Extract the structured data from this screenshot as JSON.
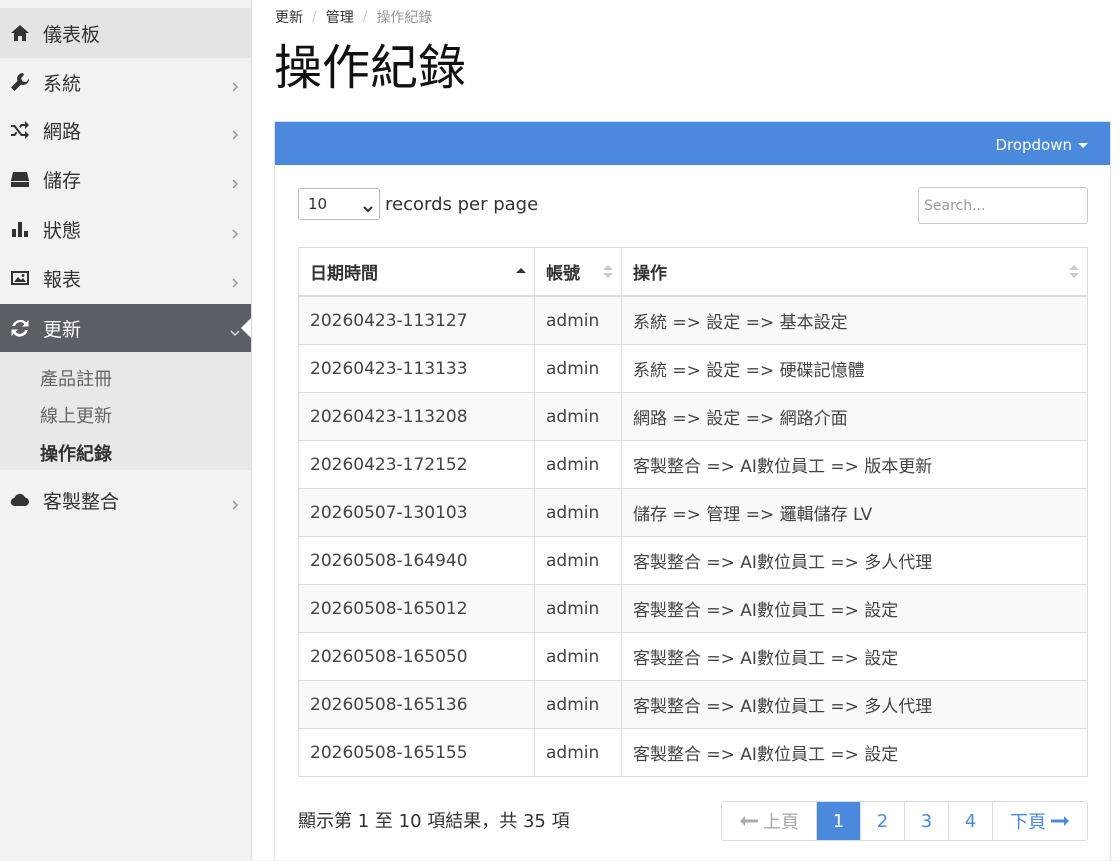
{
  "sidebar": {
    "items": [
      {
        "label": "儀表板",
        "icon": "home-icon"
      },
      {
        "label": "系統",
        "icon": "wrench-icon"
      },
      {
        "label": "網路",
        "icon": "shuffle-icon"
      },
      {
        "label": "儲存",
        "icon": "drive-icon"
      },
      {
        "label": "狀態",
        "icon": "bar-chart-icon"
      },
      {
        "label": "報表",
        "icon": "image-icon"
      },
      {
        "label": "更新",
        "icon": "refresh-icon"
      },
      {
        "label": "客製整合",
        "icon": "cloud-icon"
      }
    ],
    "sub_items": [
      "產品註冊",
      "線上更新",
      "操作紀錄"
    ]
  },
  "breadcrumb": [
    "更新",
    "管理",
    "操作紀錄"
  ],
  "page_title": "操作紀錄",
  "panel": {
    "dropdown_label": "Dropdown"
  },
  "controls": {
    "records_per_page_value": "10",
    "records_per_page_label": "records per page",
    "search_placeholder": "Search..."
  },
  "table": {
    "columns": [
      "日期時間",
      "帳號",
      "操作"
    ],
    "rows": [
      [
        "20260423-113127",
        "admin",
        "系統 => 設定 => 基本設定"
      ],
      [
        "20260423-113133",
        "admin",
        "系統 => 設定 => 硬碟記憶體"
      ],
      [
        "20260423-113208",
        "admin",
        "網路 => 設定 => 網路介面"
      ],
      [
        "20260423-172152",
        "admin",
        "客製整合 => AI數位員工 => 版本更新"
      ],
      [
        "20260507-130103",
        "admin",
        "儲存 => 管理 => 邏輯儲存 LV"
      ],
      [
        "20260508-164940",
        "admin",
        "客製整合 => AI數位員工 => 多人代理"
      ],
      [
        "20260508-165012",
        "admin",
        "客製整合 => AI數位員工 => 設定"
      ],
      [
        "20260508-165050",
        "admin",
        "客製整合 => AI數位員工 => 設定"
      ],
      [
        "20260508-165136",
        "admin",
        "客製整合 => AI數位員工 => 多人代理"
      ],
      [
        "20260508-165155",
        "admin",
        "客製整合 => AI數位員工 => 設定"
      ]
    ]
  },
  "footer": {
    "info_text": "顯示第 1 至 10 項結果，共 35 項",
    "prev_label": "上頁",
    "next_label": "下頁",
    "pages": [
      "1",
      "2",
      "3",
      "4"
    ],
    "current_page": "1"
  },
  "colors": {
    "accent": "#4a89dc",
    "sidebar_active": "#5a5f66"
  }
}
